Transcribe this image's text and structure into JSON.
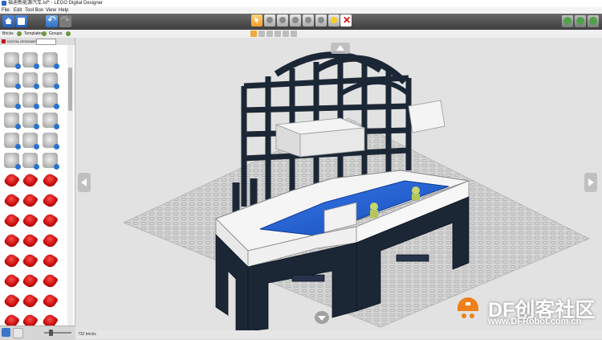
{
  "window": {
    "title": "福迪新能源汽车.lxf* - LEGO Digital Designer"
  },
  "menu": [
    "File",
    "Edit",
    "Tool Box",
    "View",
    "Help"
  ],
  "toolbar": {
    "left_buttons": [
      "home-icon",
      "save-icon",
      "undo-icon",
      "redo-icon"
    ],
    "tools": [
      "select-cursor-icon",
      "clone-icon",
      "hinge-icon",
      "hinge-align-icon",
      "flex-icon",
      "paint-bucket-icon",
      "hide-icon",
      "delete-icon"
    ],
    "right_buttons": [
      "view-mode-build-icon",
      "view-mode-view-icon",
      "building-guide-icon"
    ]
  },
  "palette_tabs": {
    "bricks": "Bricks",
    "templates": "Templates",
    "groups": "Groups"
  },
  "palette": {
    "header_label": "DIGITAL DESIGNER",
    "gray_bricks": 18,
    "red_bricks": 24
  },
  "status": {
    "brick_count": "732 bricks"
  },
  "watermark": {
    "brand": "DF创客社区",
    "url": "www.DFRobot.com.cn"
  },
  "colors": {
    "toolbar_top": "#6a6a6a",
    "toolbar_bottom": "#3e3e3e",
    "selected_tool": "#f09d28",
    "palette_red": "#c40c0c",
    "baseplate": "#d0d0d0",
    "model_dark": "#1c2736",
    "water_blue": "#1f5fd0"
  }
}
